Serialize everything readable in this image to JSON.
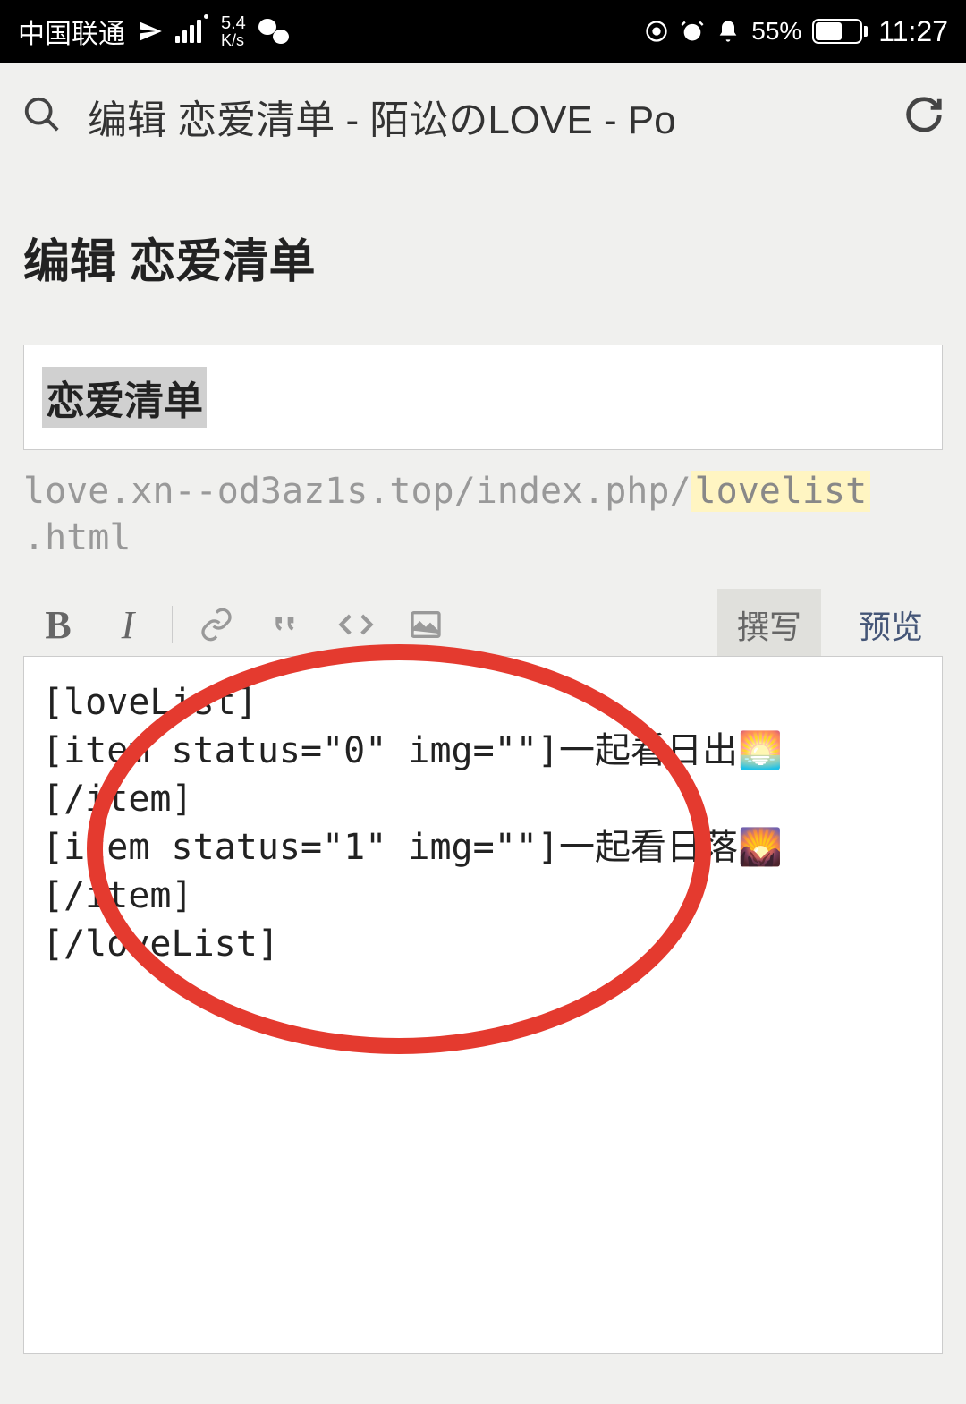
{
  "status": {
    "carrier": "中国联通",
    "speed_val": "5.4",
    "speed_unit": "K/s",
    "battery_pct": "55%",
    "time": "11:27"
  },
  "browser": {
    "title": "编辑 恋爱清单 - 陌讼のLOVE - Po"
  },
  "page": {
    "heading": "编辑 恋爱清单",
    "title_value": "恋爱清单",
    "url_prefix": "love.xn--od3az1s.top/index.php/",
    "url_slug": "lovelist",
    "url_suffix": ".html"
  },
  "toolbar": {
    "bold": "B",
    "italic": "I",
    "write_tab": "撰写",
    "preview_tab": "预览"
  },
  "editor": {
    "content": "[loveList]\n[item status=\"0\" img=\"\"]一起看日出🌅\n[/item]\n[item status=\"1\" img=\"\"]一起看日落🌄\n[/item]\n[/loveList]"
  }
}
